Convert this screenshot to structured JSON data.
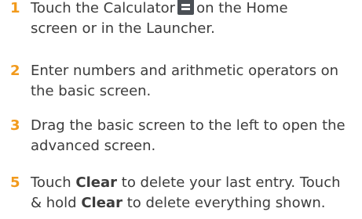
{
  "steps": [
    {
      "number": "1",
      "line1_before": "Touch the Calculator",
      "icon": "calculator-icon",
      "line1_after": "on the Home",
      "line2": "screen or in the Launcher."
    },
    {
      "number": "2",
      "line1": "Enter numbers and arithmetic operators on",
      "line2": "the basic screen."
    },
    {
      "number": "3",
      "line1": "Drag the basic screen to the left to open the",
      "line2": "advanced screen."
    },
    {
      "number": "5",
      "line1_before": "Touch",
      "bold1": "Clear",
      "line1_after": "to delete your last entry. Touch",
      "line2_before": "& hold",
      "bold2": "Clear",
      "line2_after": "to delete everything shown."
    }
  ],
  "colors": {
    "step_number": "#f29a1c",
    "body_text": "#3c3c3c",
    "icon_bg": "#4a4f55"
  }
}
